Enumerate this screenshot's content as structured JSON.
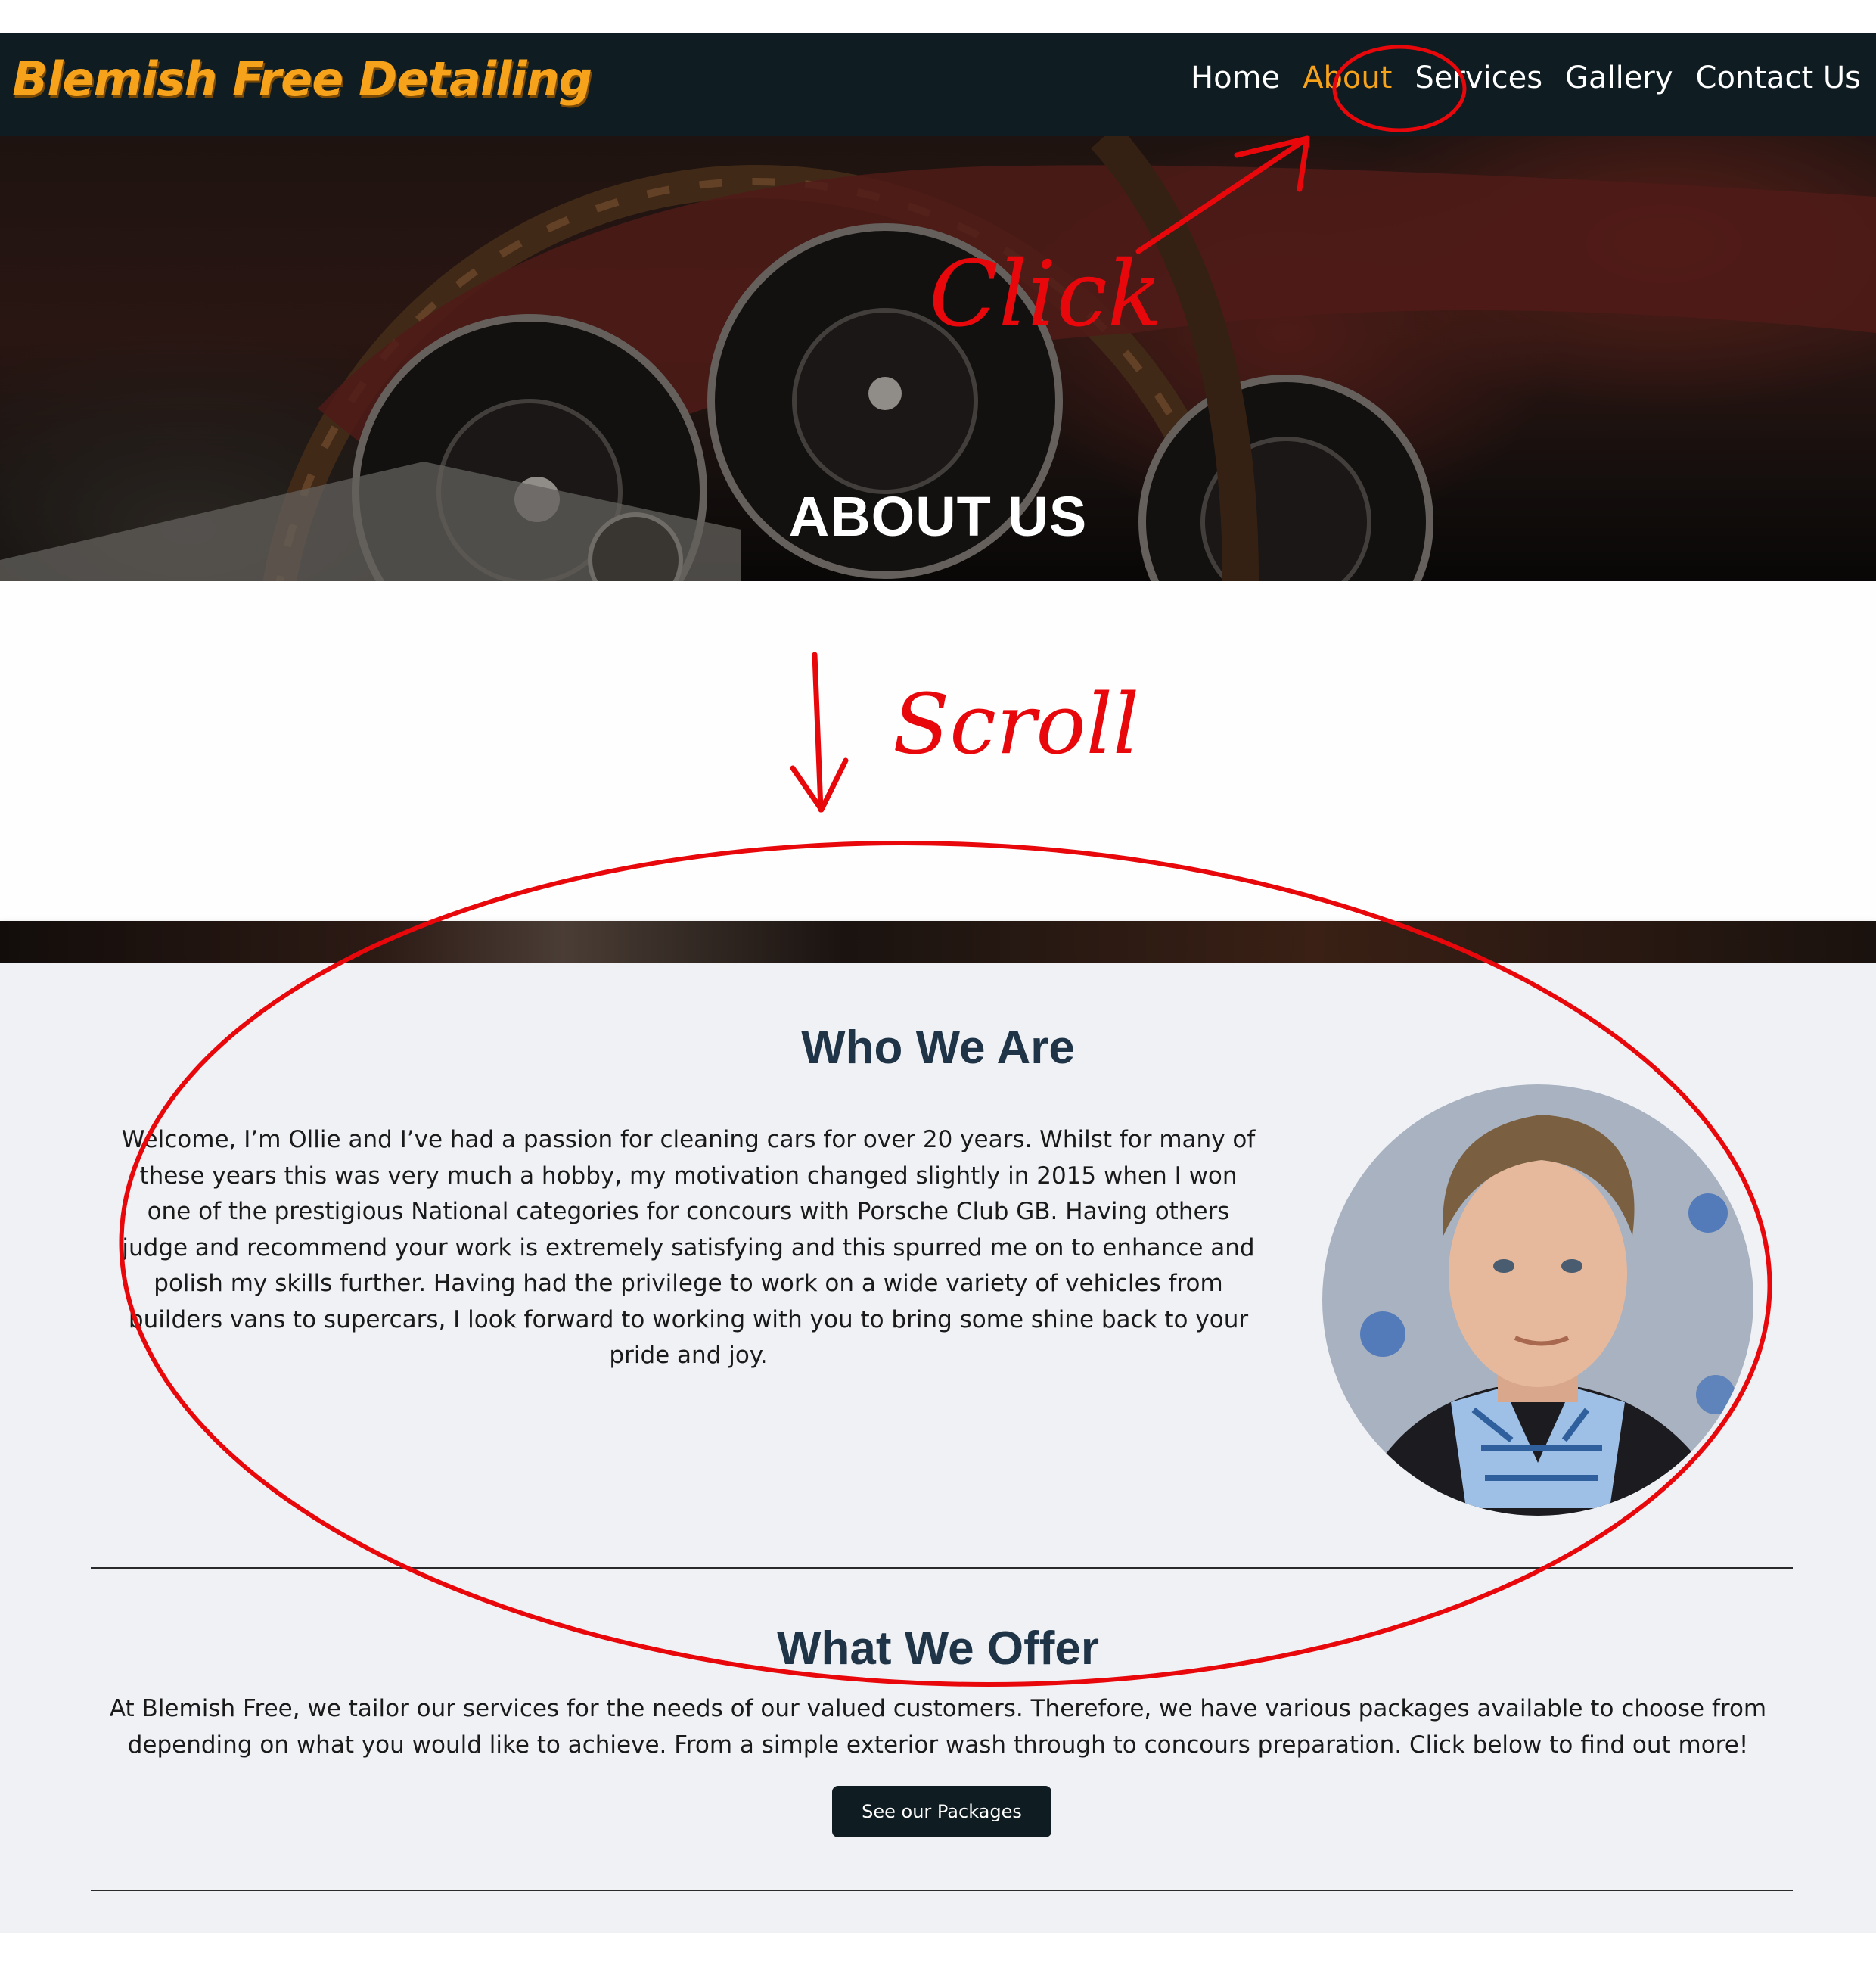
{
  "brand": {
    "name": "Blemish Free Detailing",
    "color": "#f7a21b"
  },
  "nav": {
    "items": [
      {
        "label": "Home",
        "active": false
      },
      {
        "label": "About",
        "active": true
      },
      {
        "label": "Services",
        "active": false
      },
      {
        "label": "Gallery",
        "active": false
      },
      {
        "label": "Contact Us",
        "active": false
      }
    ]
  },
  "hero": {
    "title": "ABOUT US"
  },
  "who": {
    "title": "Who We Are",
    "text": "Welcome, I’m Ollie and I’ve had a passion for cleaning cars for over 20 years. Whilst for many of these years this was very much a hobby, my motivation changed slightly in 2015 when I won one of the prestigious National categories for concours with Porsche Club GB. Having others judge and recommend your work is extremely satisfying and this spurred me on to enhance and polish my skills further. Having had the privilege to work on a wide variety of vehicles from builders vans to supercars, I look forward to working with you to bring some shine back to your pride and joy."
  },
  "offer": {
    "title": "What We Offer",
    "text": "At Blemish Free, we tailor our services for the needs of our valued customers. Therefore, we have various packages available to choose from depending on what you would like to achieve. From a simple exterior wash through to concours preparation. Click below to find out more!",
    "button_label": "See our Packages"
  },
  "annotations": {
    "click_label": "Click",
    "scroll_label": "Scroll",
    "color": "#e8080c"
  }
}
